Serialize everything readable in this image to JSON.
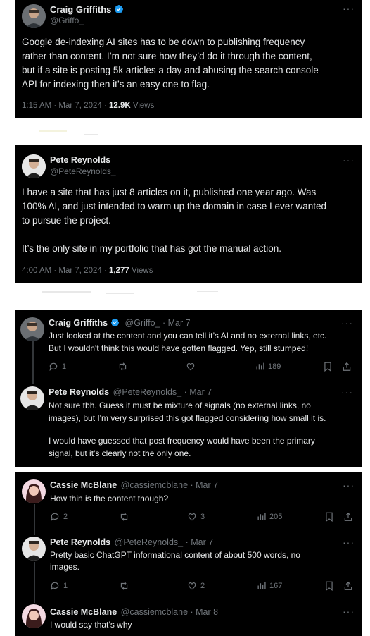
{
  "tweet1": {
    "name": "Craig Griffiths",
    "handle": "@Griffo_",
    "lines": [
      "Google de-indexing AI sites has to be down to publishing frequency",
      "rather than content. I’m not sure how they’d do it through the content,",
      "but if a site is posting 5k articles a day and abusing the search console",
      "API for indexing then it’s an easy one to flag."
    ],
    "timestamp": "1:15 AM · Mar 7, 2024 · ",
    "views_count": "12.9K",
    "views_label": " Views",
    "more": "···"
  },
  "tweet2": {
    "name": "Pete Reynolds",
    "handle": "@PeteReynolds_",
    "lines": [
      "I have a site that has just 8 articles on it, published one year ago. Was",
      "100% AI, and just intended to warm up the domain in case I ever wanted",
      "to pursue the project.",
      "It’s the only site in my portfolio that has got the manual action."
    ],
    "timestamp": "4:00 AM · Mar 7, 2024 · ",
    "views_count": "1,277",
    "views_label": " Views",
    "more": "···"
  },
  "reply1": {
    "name": "Craig Griffiths",
    "meta": "@Griffo_ · Mar 7",
    "lines": [
      "Just looked at the content and you can tell it’s AI and no external links, etc.",
      "But I wouldn't think this would have gotten flagged. Yep, still stumped!"
    ],
    "replies": "1",
    "views": "189",
    "more": "···"
  },
  "reply2": {
    "name": "Pete Reynolds",
    "meta": "@PeteReynolds_ · Mar 7",
    "lines": [
      "Not sure tbh. Guess it must be mixture of signals (no external links, no",
      "images), but I'm very surprised this got flagged considering how small it is.",
      "I would have guessed that post frequency would have been the primary",
      "signal, but it's clearly not the only one."
    ],
    "more": "···"
  },
  "reply3": {
    "name": "Cassie McBlane",
    "meta": "@cassiemcblane · Mar 7",
    "lines": [
      "How thin is the content though?"
    ],
    "replies": "2",
    "likes": "3",
    "views": "205",
    "more": "···"
  },
  "reply4": {
    "name": "Pete Reynolds",
    "meta": "@PeteReynolds_ · Mar 7",
    "lines": [
      "Pretty basic ChatGPT informational content of about 500 words, no",
      "images."
    ],
    "replies": "1",
    "likes": "2",
    "views": "167",
    "more": "···"
  },
  "reply5": {
    "name": "Cassie McBlane",
    "meta": "@cassiemcblane · Mar 8",
    "lines": [
      "I would say that’s why"
    ],
    "more": "···"
  },
  "colors": {
    "background": "#000000",
    "text": "#e7e9ea",
    "muted": "#71767b",
    "verified": "#1d9bf0"
  }
}
